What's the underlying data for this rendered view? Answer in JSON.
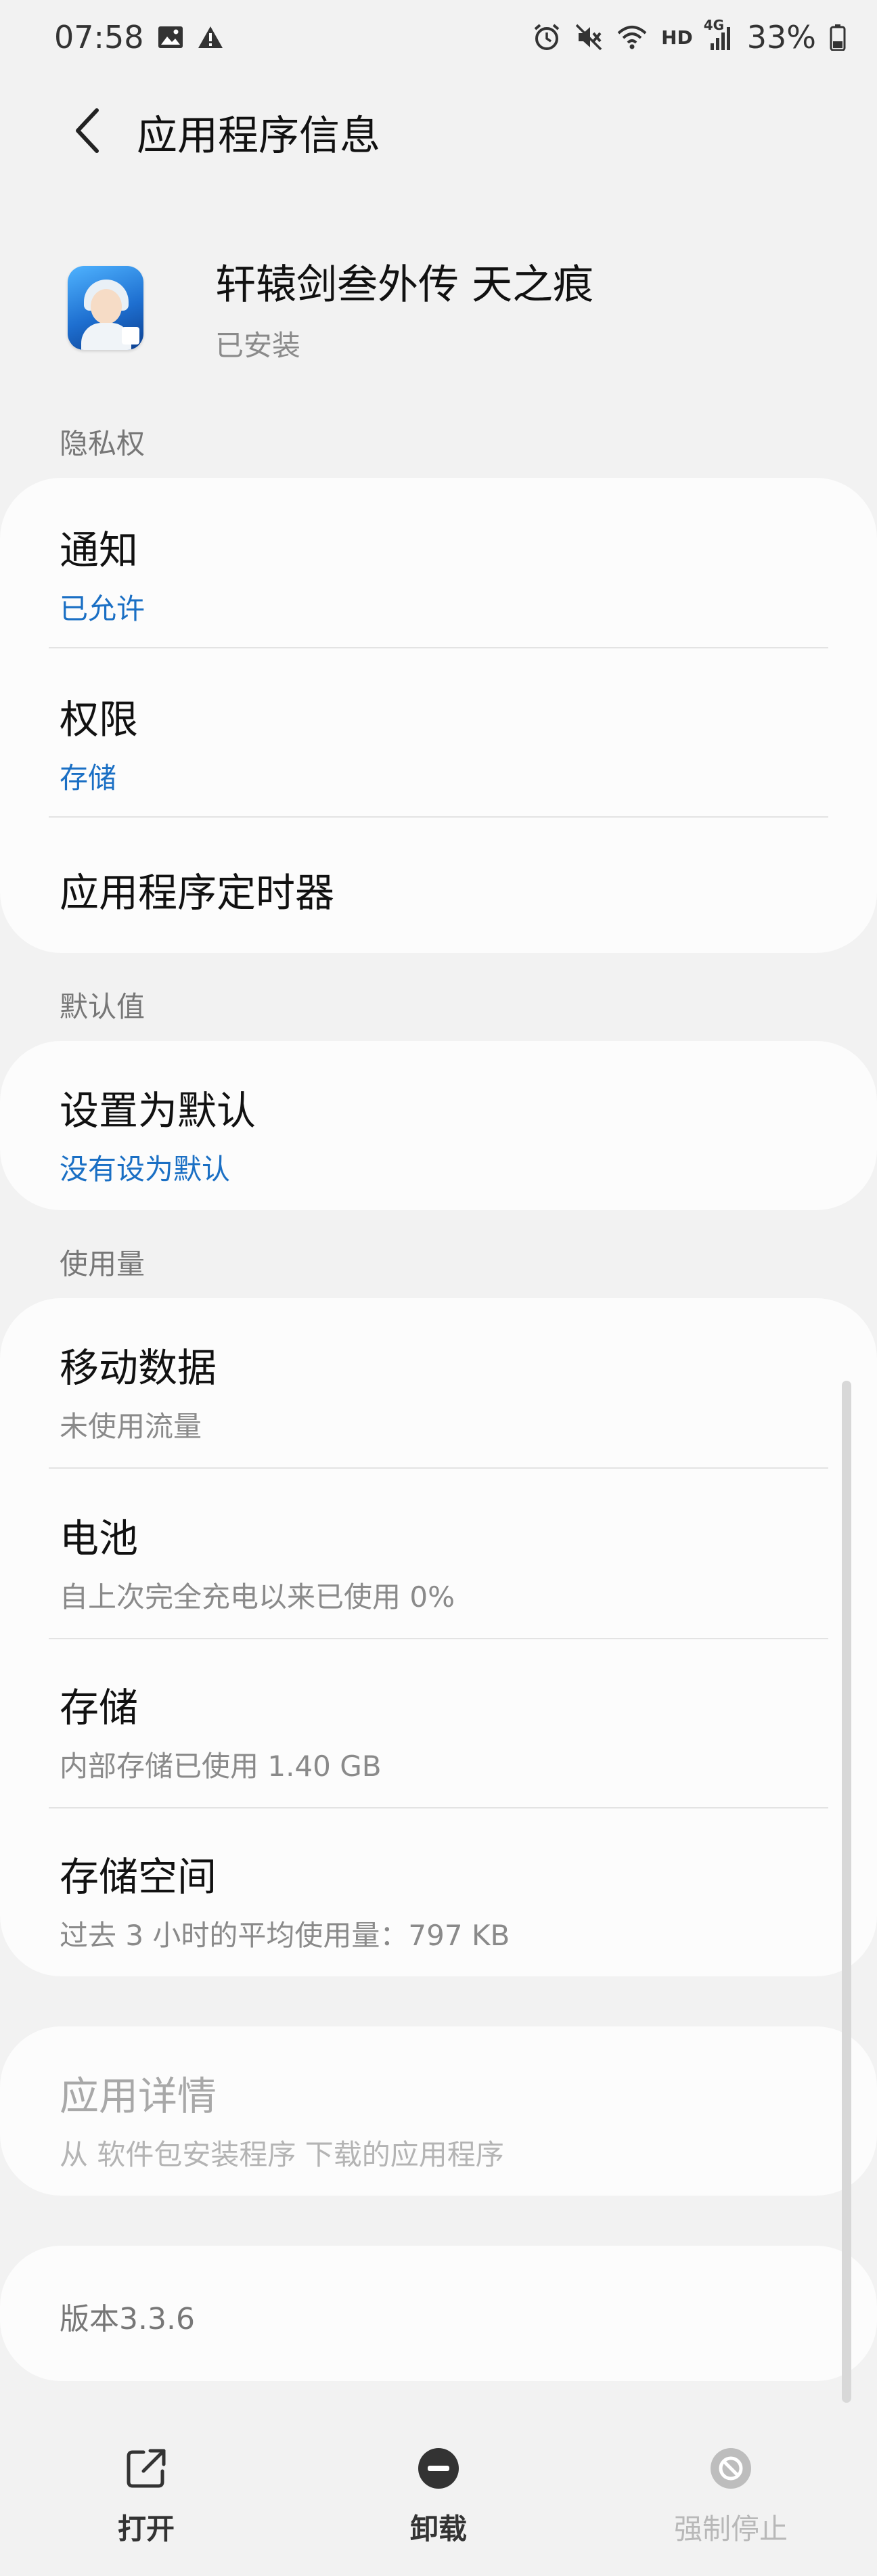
{
  "status_bar": {
    "time": "07:58",
    "net_label": "HD",
    "net_type": "4G",
    "battery": "33%"
  },
  "header": {
    "title": "应用程序信息"
  },
  "app": {
    "name": "轩辕剑叁外传 天之痕",
    "status": "已安装"
  },
  "sections": {
    "privacy": "隐私权",
    "defaults": "默认值",
    "usage": "使用量"
  },
  "privacy_items": [
    {
      "title": "通知",
      "sub": "已允许"
    },
    {
      "title": "权限",
      "sub": "存储"
    },
    {
      "title": "应用程序定时器"
    }
  ],
  "default_items": [
    {
      "title": "设置为默认",
      "sub": "没有设为默认"
    }
  ],
  "usage_items": [
    {
      "title": "移动数据",
      "sub": "未使用流量"
    },
    {
      "title": "电池",
      "sub": "自上次完全充电以来已使用 0%"
    },
    {
      "title": "存储",
      "sub": "内部存储已使用 1.40 GB"
    },
    {
      "title": "存储空间",
      "sub": "过去 3 小时的平均使用量：797 KB"
    }
  ],
  "details": {
    "title": "应用详情",
    "sub": "从 软件包安装程序 下载的应用程序"
  },
  "version": "版本3.3.6",
  "bottom_nav": {
    "open": "打开",
    "uninstall": "卸载",
    "force_stop": "强制停止"
  },
  "icons": {
    "back": "chevron-left-icon",
    "open": "external-link-icon",
    "uninstall": "minus-circle-icon",
    "force_stop": "block-circle-icon"
  }
}
